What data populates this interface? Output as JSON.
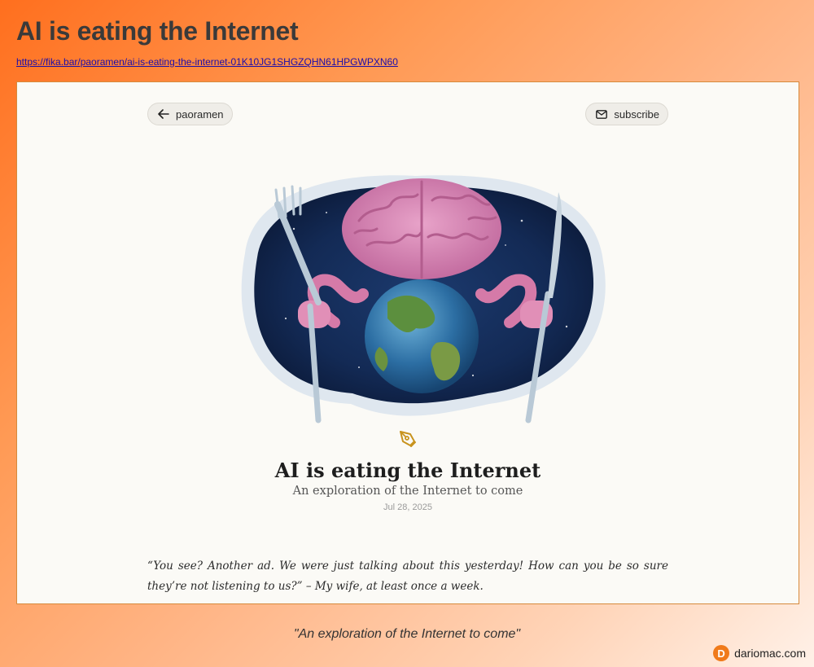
{
  "page": {
    "title": "AI is eating the Internet",
    "url": "https://fika.bar/paoramen/ai-is-eating-the-internet-01K10JG1SHGZQHN61HPGWPXN60",
    "caption": "\"An exploration of the Internet to come\""
  },
  "nav": {
    "back_label": "paoramen",
    "subscribe_label": "subscribe"
  },
  "article": {
    "title": "AI is eating the Internet",
    "subtitle": "An exploration of the Internet to come",
    "date": "Jul 28, 2025",
    "quote": "“You see? Another ad. We were just talking about this yesterday! How can you be so sure they’re not listening to us?” – My wife, at least once a week."
  },
  "hero": {
    "description_icon": "brain-eating-earth-illustration"
  },
  "brand": {
    "logo_letter": "D",
    "name": "dariomac.com"
  },
  "colors": {
    "accent": "#f07a1a",
    "pen_icon": "#c8931e",
    "space": "#132a55"
  }
}
